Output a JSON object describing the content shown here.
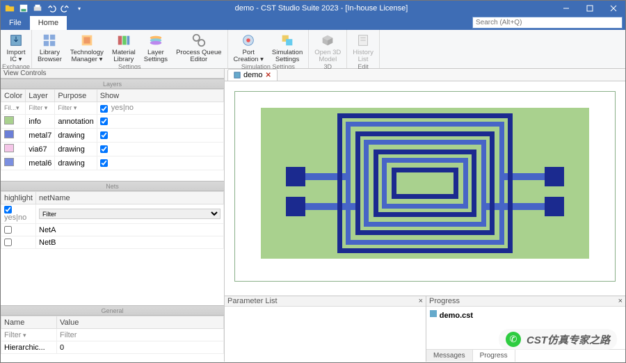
{
  "title": "demo - CST Studio Suite 2023 - [In-house License]",
  "menu": {
    "file": "File",
    "home": "Home"
  },
  "search_placeholder": "Search (Alt+Q)",
  "ribbon": {
    "exchange": {
      "label": "Exchange",
      "import": "Import\nIC ▾"
    },
    "settings": {
      "label": "Settings",
      "library": "Library\nBrowser",
      "tech": "Technology\nManager ▾",
      "material": "Material\nLibrary",
      "layer": "Layer\nSettings",
      "pq": "Process Queue\nEditor"
    },
    "sim": {
      "label": "Simulation Settings",
      "port": "Port\nCreation ▾",
      "simset": "Simulation\nSettings"
    },
    "threed": {
      "label": "3D",
      "open3d": "Open 3D\nModel"
    },
    "edit": {
      "label": "Edit",
      "history": "History\nList"
    }
  },
  "view_controls": "View Controls",
  "layers_hdr": "Layers",
  "layers": {
    "cols": {
      "color": "Color",
      "layer": "Layer",
      "purpose": "Purpose",
      "show": "Show"
    },
    "filter": {
      "fil": "Fil...▾",
      "filter": "Filter ▾",
      "filter2": "Filter   ▾",
      "yesno": "yes|no"
    },
    "rows": [
      {
        "color": "#a9d18e",
        "layer": "info",
        "purpose": "annotation"
      },
      {
        "color": "#6b7fd7",
        "layer": "metal7",
        "purpose": "drawing"
      },
      {
        "color": "#f5c6e8",
        "layer": "via67",
        "purpose": "drawing"
      },
      {
        "color": "#7b8fe0",
        "layer": "metal6",
        "purpose": "drawing"
      }
    ]
  },
  "nets_hdr": "Nets",
  "nets": {
    "cols": {
      "hl": "highlight",
      "name": "netName"
    },
    "filter": {
      "yesno": "yes|no",
      "filter": "Filter"
    },
    "rows": [
      {
        "name": "NetA"
      },
      {
        "name": "NetB"
      }
    ]
  },
  "general_hdr": "General",
  "general": {
    "cols": {
      "name": "Name",
      "value": "Value"
    },
    "filter": {
      "filter": "Filter"
    },
    "rows": [
      {
        "name": "Hierarchic...",
        "value": "0"
      }
    ]
  },
  "doc_tab": "demo",
  "param_list": "Parameter List",
  "progress": "Progress",
  "progress_file": "demo.cst",
  "tabs": {
    "messages": "Messages",
    "progress": "Progress"
  },
  "watermark": "CST仿真专家之路"
}
